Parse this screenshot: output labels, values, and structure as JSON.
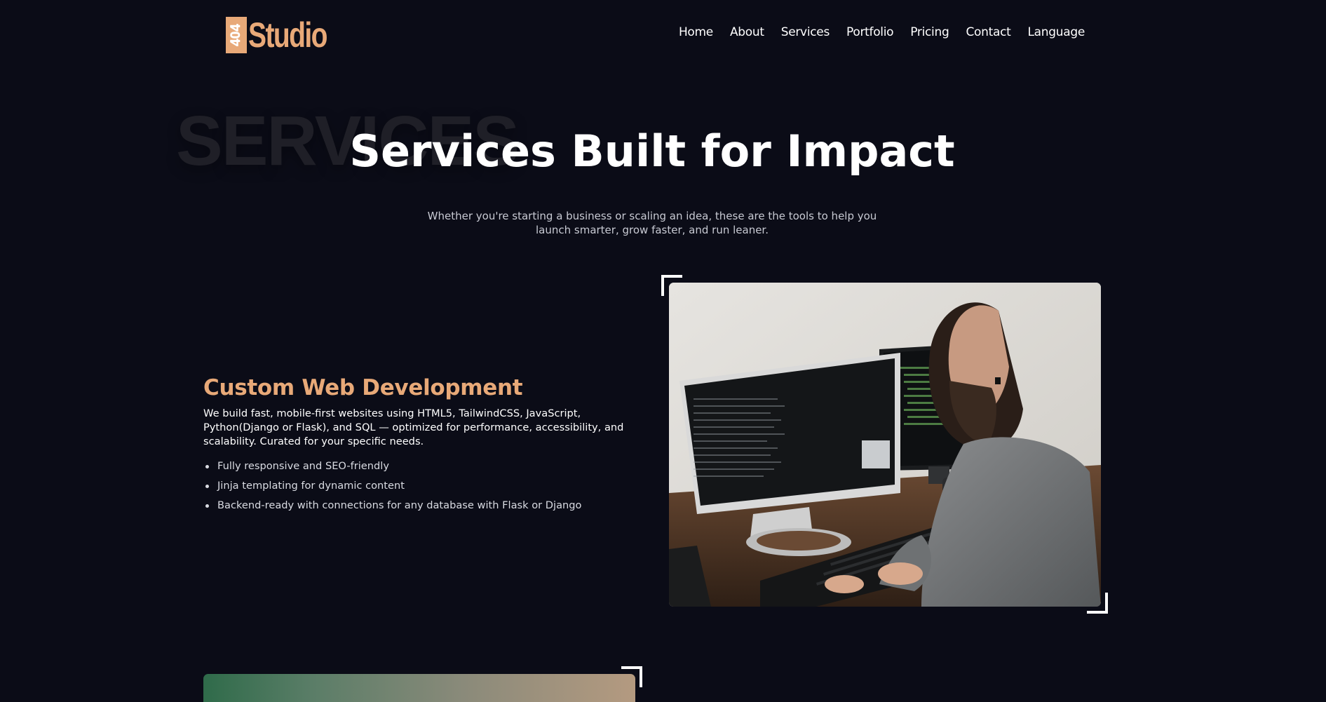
{
  "header": {
    "logo_mark_text": "404",
    "logo_text": "Studio",
    "nav": [
      "Home",
      "About",
      "Services",
      "Portfolio",
      "Pricing",
      "Contact",
      "Language"
    ]
  },
  "hero": {
    "bg_word": "SERVICES",
    "title": "Services Built for Impact",
    "subtitle": "Whether you're starting a business or scaling an idea, these are the tools to help you launch smarter, grow faster, and run leaner."
  },
  "service": {
    "title": "Custom Web Development",
    "description": "We build fast, mobile-first websites using HTML5, TailwindCSS, JavaScript, Python(Django or Flask), and SQL — optimized for performance, accessibility, and scalability. Curated for your specific needs.",
    "features": [
      "Fully responsive and SEO-friendly",
      "Jinja templating for dynamic content",
      "Backend-ready with connections for any database with Flask or Django"
    ]
  },
  "colors": {
    "background": "#0b0c17",
    "accent": "#e8a978",
    "text": "#ffffff"
  }
}
